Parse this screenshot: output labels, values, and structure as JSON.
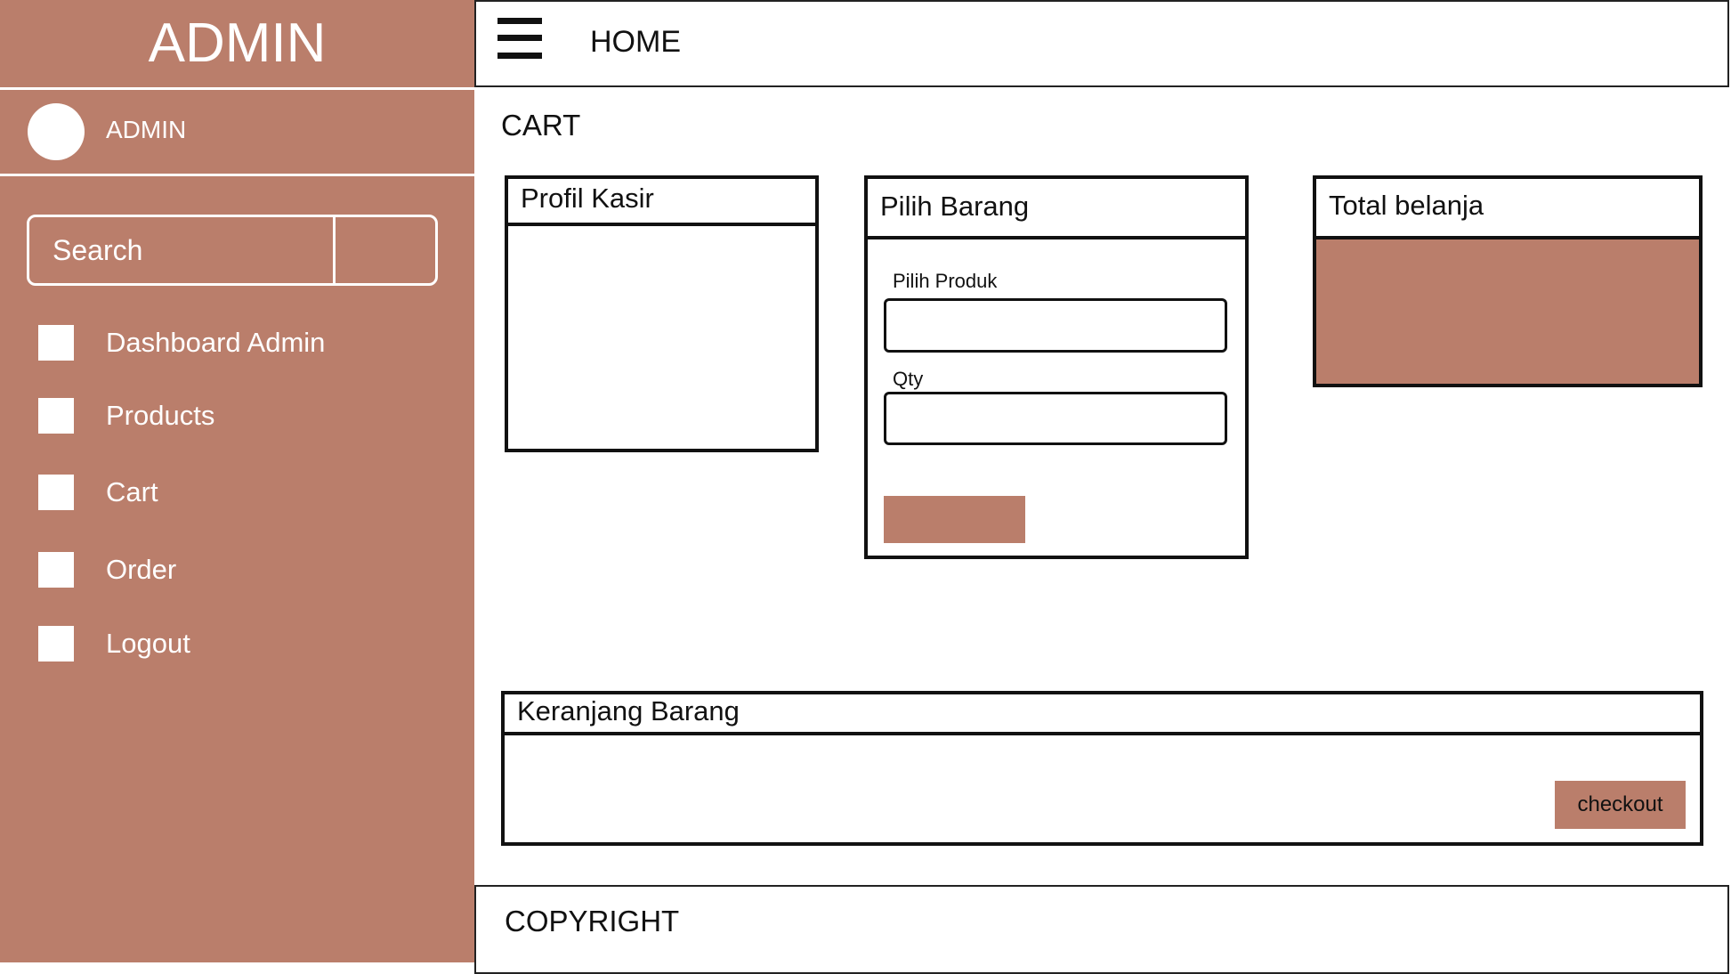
{
  "sidebar": {
    "title": "ADMIN",
    "user_name": "ADMIN",
    "search_placeholder": "Search",
    "items": [
      {
        "label": "Dashboard Admin"
      },
      {
        "label": "Products"
      },
      {
        "label": "Cart"
      },
      {
        "label": "Order"
      },
      {
        "label": "Logout"
      }
    ]
  },
  "header": {
    "title": "HOME"
  },
  "page": {
    "title": "CART"
  },
  "profil_kasir": {
    "title": "Profil Kasir"
  },
  "pilih_barang": {
    "title": "Pilih Barang",
    "produk_label": "Pilih Produk",
    "produk_value": "",
    "qty_label": "Qty",
    "qty_value": ""
  },
  "total_belanja": {
    "title": "Total belanja"
  },
  "keranjang": {
    "title": "Keranjang Barang",
    "checkout_label": "checkout"
  },
  "footer": {
    "text": "COPYRIGHT"
  },
  "colors": {
    "accent": "#ba7e6b"
  }
}
